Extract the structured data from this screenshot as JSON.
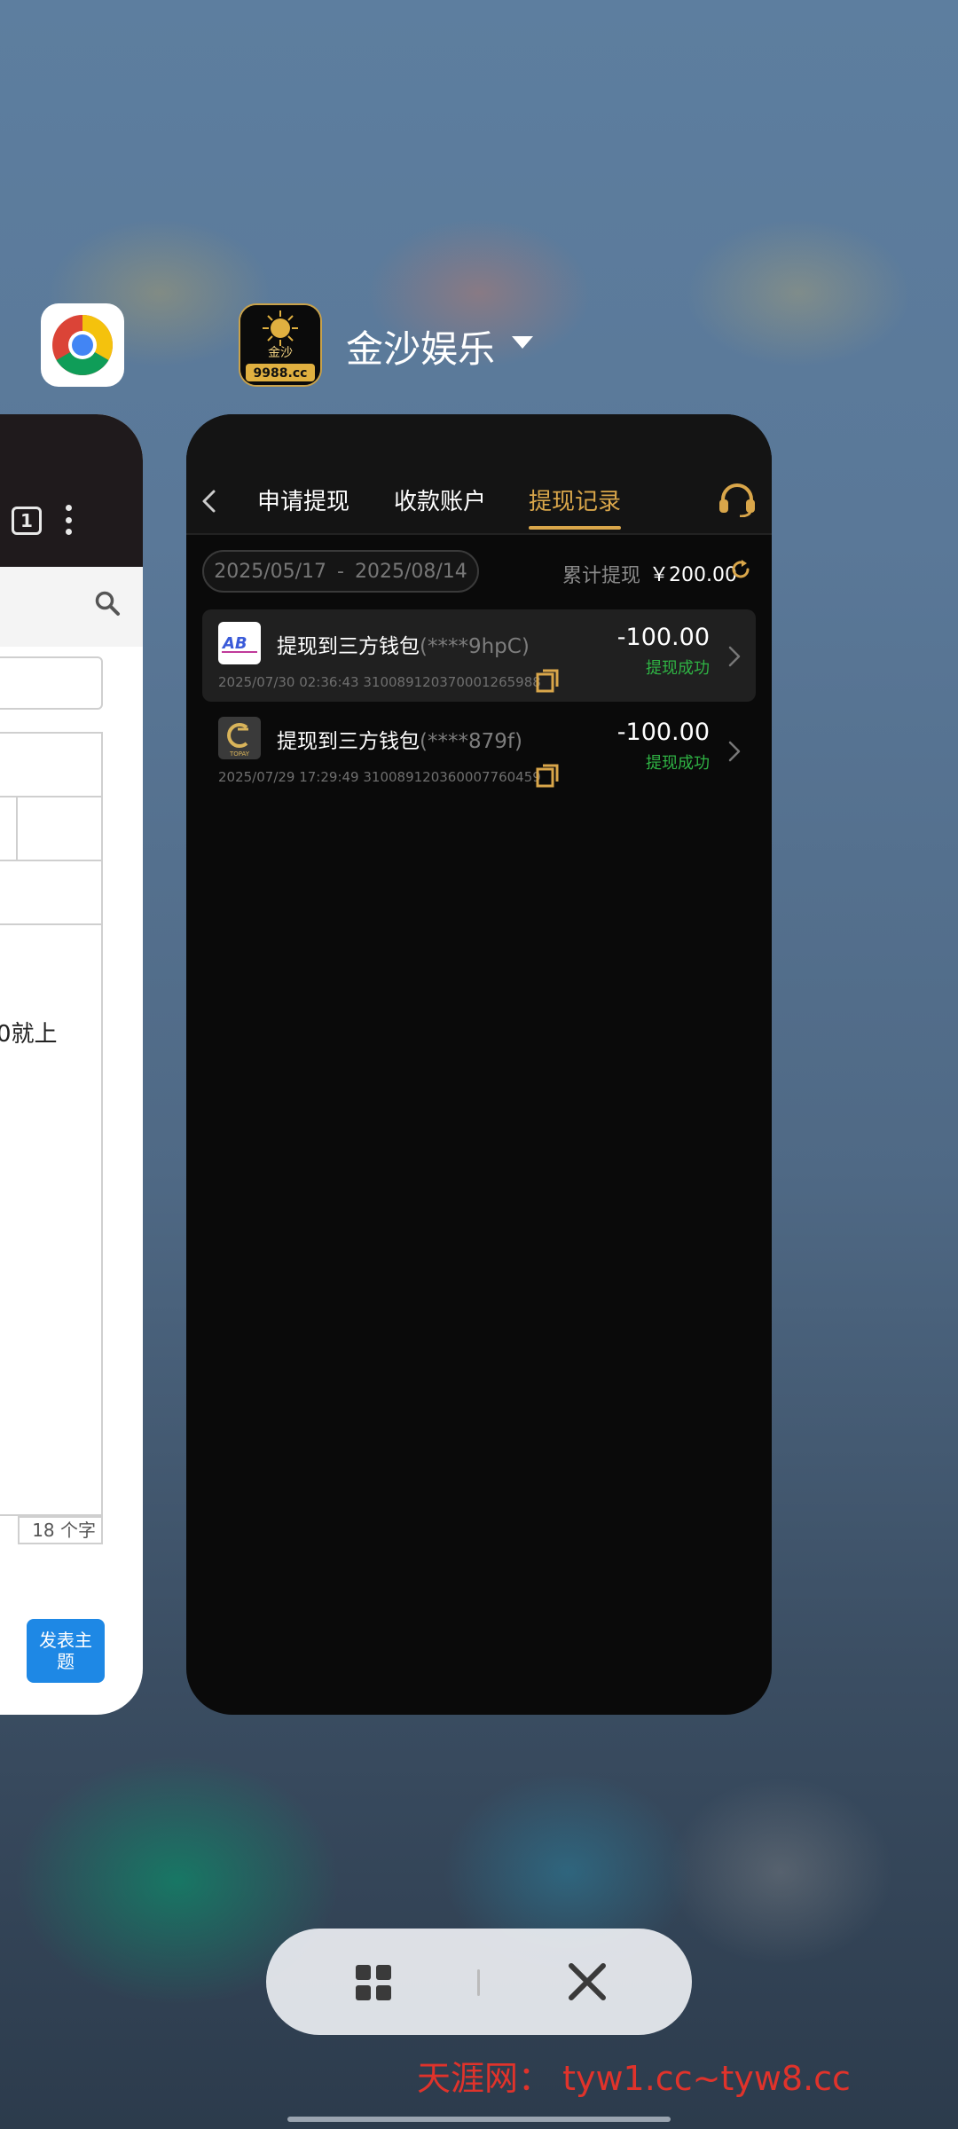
{
  "recents": {
    "left_app": {
      "icon": "chrome-icon",
      "tab_count": "1",
      "body_text": "0就上",
      "char_count": "18 个字",
      "post_button": "发表主题"
    },
    "main_app": {
      "name": "金沙娱乐",
      "icon": "app-logo",
      "logo_text": "9988.cc",
      "logo_brand": "金沙",
      "tabs": [
        {
          "label": "申请提现",
          "active": false
        },
        {
          "label": "收款账户",
          "active": false
        },
        {
          "label": "提现记录",
          "active": true
        }
      ],
      "date_range": {
        "start": "2025/05/17",
        "separator": "-",
        "end": "2025/08/14"
      },
      "total_label": "累计提现",
      "total_value": "￥200.00",
      "records": [
        {
          "title": "提现到三方钱包",
          "account": "(****9hpC)",
          "datetime": "2025/07/30 02:36:43",
          "order_id": "310089120370001265988",
          "amount": "-100.00",
          "status": "提现成功",
          "logo_text": "AB"
        },
        {
          "title": "提现到三方钱包",
          "account": "(****879f)",
          "datetime": "2025/07/29 17:29:49",
          "order_id": "310089120360007760459",
          "amount": "-100.00",
          "status": "提现成功",
          "logo_text": "TOPAY"
        }
      ]
    }
  },
  "watermark": "天涯网： tyw1.cc~tyw8.cc",
  "colors": {
    "accent": "#d9a64a",
    "success": "#2fb344",
    "card_bg": "#0a0a0a",
    "post_button": "#1e88e5",
    "watermark": "#e0332b"
  }
}
